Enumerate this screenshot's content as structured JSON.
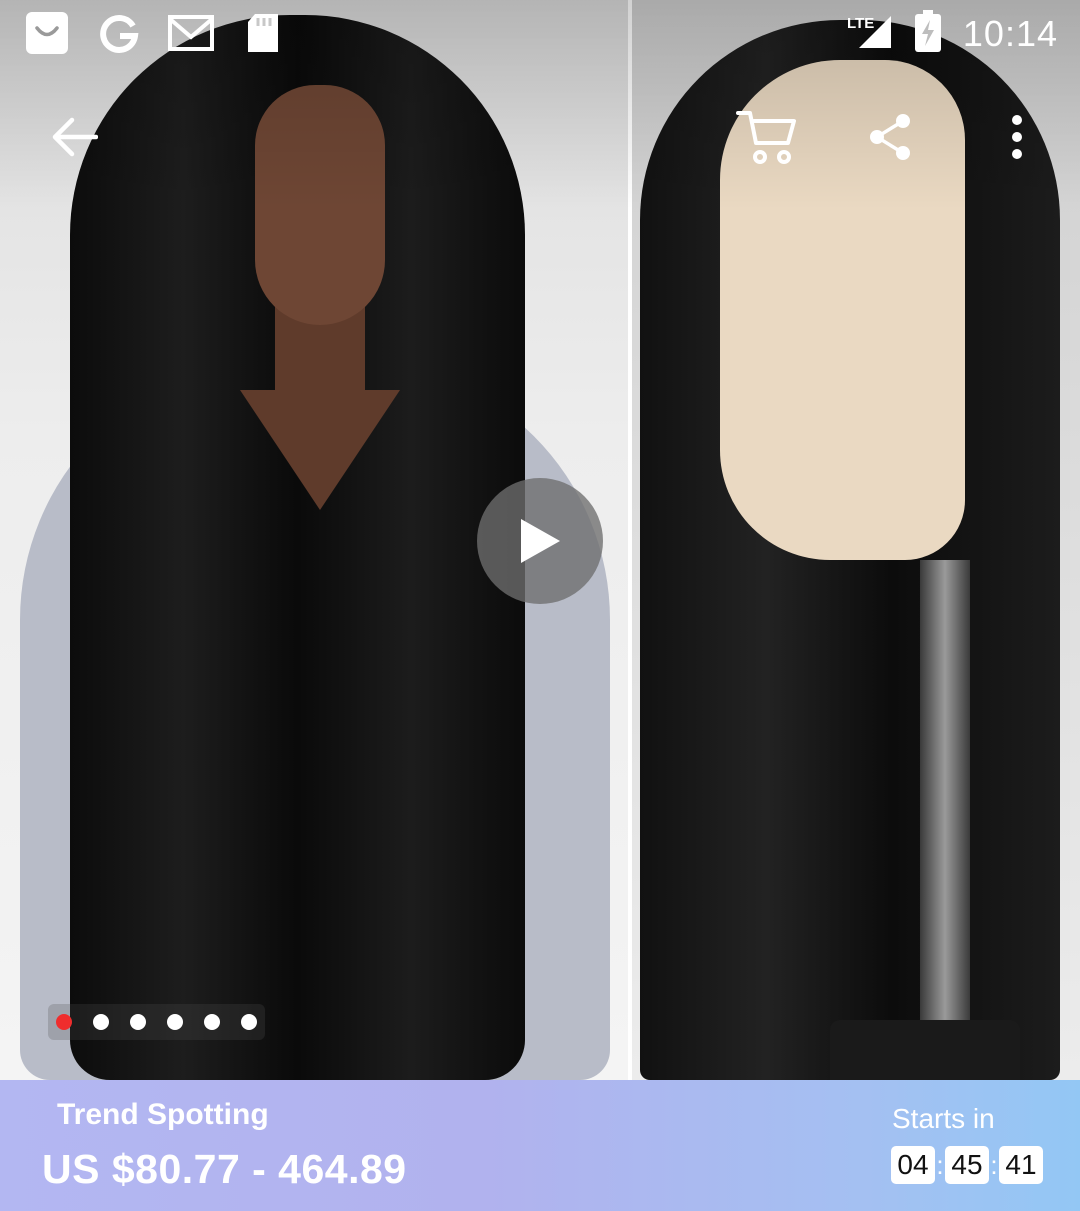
{
  "status_bar": {
    "time": "10:14",
    "network": "LTE",
    "notification_icons": [
      "aliexpress-icon",
      "google-icon",
      "gmail-icon",
      "sd-card-icon"
    ]
  },
  "toolbar": {
    "icons": [
      "arrow-back-icon",
      "shopping-cart-icon",
      "share-icon",
      "more-vert-icon"
    ]
  },
  "gallery": {
    "dot_count": 6,
    "active_index": 0,
    "accent_color": "#ef2d2d"
  },
  "promo": {
    "title": "Trend Spotting",
    "price": "US $80.77 - 464.89",
    "starts_label": "Starts in",
    "countdown": {
      "hours": "04",
      "minutes": "45",
      "seconds": "41"
    }
  }
}
